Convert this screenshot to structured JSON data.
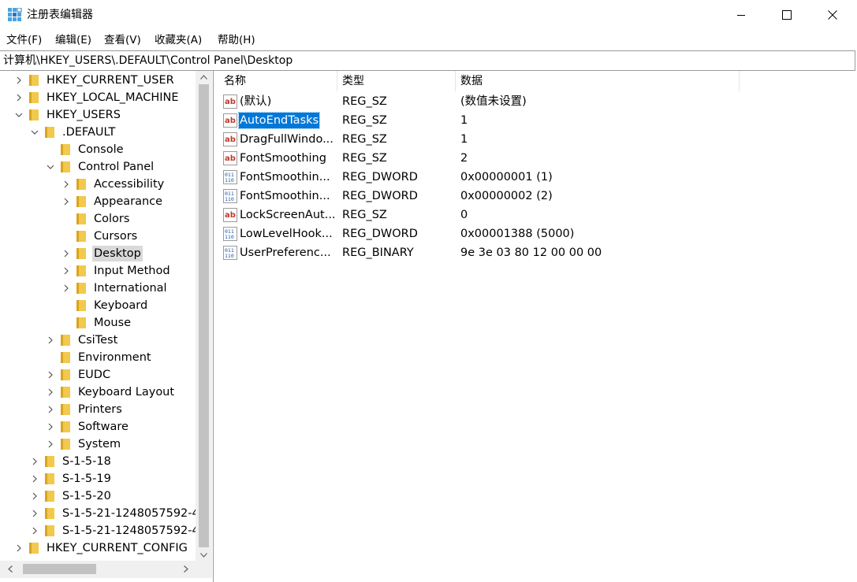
{
  "window": {
    "title": "注册表编辑器"
  },
  "menu": [
    {
      "label": "文件(F)"
    },
    {
      "label": "编辑(E)"
    },
    {
      "label": "查看(V)"
    },
    {
      "label": "收藏夹(A)"
    },
    {
      "label": "帮助(H)"
    }
  ],
  "address": "计算机\\HKEY_USERS\\.DEFAULT\\Control Panel\\Desktop",
  "tree": [
    {
      "label": "HKEY_CURRENT_USER",
      "level": 0,
      "exp": "collapsed"
    },
    {
      "label": "HKEY_LOCAL_MACHINE",
      "level": 0,
      "exp": "collapsed"
    },
    {
      "label": "HKEY_USERS",
      "level": 0,
      "exp": "expanded"
    },
    {
      "label": ".DEFAULT",
      "level": 1,
      "exp": "expanded"
    },
    {
      "label": "Console",
      "level": 2,
      "exp": "none"
    },
    {
      "label": "Control Panel",
      "level": 2,
      "exp": "expanded"
    },
    {
      "label": "Accessibility",
      "level": 3,
      "exp": "collapsed"
    },
    {
      "label": "Appearance",
      "level": 3,
      "exp": "collapsed"
    },
    {
      "label": "Colors",
      "level": 3,
      "exp": "none"
    },
    {
      "label": "Cursors",
      "level": 3,
      "exp": "none"
    },
    {
      "label": "Desktop",
      "level": 3,
      "exp": "collapsed",
      "selected": true
    },
    {
      "label": "Input Method",
      "level": 3,
      "exp": "collapsed"
    },
    {
      "label": "International",
      "level": 3,
      "exp": "collapsed"
    },
    {
      "label": "Keyboard",
      "level": 3,
      "exp": "none"
    },
    {
      "label": "Mouse",
      "level": 3,
      "exp": "none"
    },
    {
      "label": "CsiTest",
      "level": 2,
      "exp": "collapsed"
    },
    {
      "label": "Environment",
      "level": 2,
      "exp": "none"
    },
    {
      "label": "EUDC",
      "level": 2,
      "exp": "collapsed"
    },
    {
      "label": "Keyboard Layout",
      "level": 2,
      "exp": "collapsed"
    },
    {
      "label": "Printers",
      "level": 2,
      "exp": "collapsed"
    },
    {
      "label": "Software",
      "level": 2,
      "exp": "collapsed"
    },
    {
      "label": "System",
      "level": 2,
      "exp": "collapsed"
    },
    {
      "label": "S-1-5-18",
      "level": 1,
      "exp": "collapsed"
    },
    {
      "label": "S-1-5-19",
      "level": 1,
      "exp": "collapsed"
    },
    {
      "label": "S-1-5-20",
      "level": 1,
      "exp": "collapsed"
    },
    {
      "label": "S-1-5-21-1248057592-4",
      "level": 1,
      "exp": "collapsed"
    },
    {
      "label": "S-1-5-21-1248057592-4",
      "level": 1,
      "exp": "collapsed"
    },
    {
      "label": "HKEY_CURRENT_CONFIG",
      "level": 0,
      "exp": "collapsed"
    }
  ],
  "columns": {
    "name": "名称",
    "type": "类型",
    "data": "数据"
  },
  "values": [
    {
      "icon": "string-value-icon",
      "name": "(默认)",
      "type": "REG_SZ",
      "data": "(数值未设置)"
    },
    {
      "icon": "string-value-icon",
      "name": "AutoEndTasks",
      "type": "REG_SZ",
      "data": "1",
      "selected": true
    },
    {
      "icon": "string-value-icon",
      "name": "DragFullWindo...",
      "type": "REG_SZ",
      "data": "1"
    },
    {
      "icon": "string-value-icon",
      "name": "FontSmoothing",
      "type": "REG_SZ",
      "data": "2"
    },
    {
      "icon": "binary-value-icon",
      "name": "FontSmoothin...",
      "type": "REG_DWORD",
      "data": "0x00000001 (1)"
    },
    {
      "icon": "binary-value-icon",
      "name": "FontSmoothin...",
      "type": "REG_DWORD",
      "data": "0x00000002 (2)"
    },
    {
      "icon": "string-value-icon",
      "name": "LockScreenAut...",
      "type": "REG_SZ",
      "data": "0"
    },
    {
      "icon": "binary-value-icon",
      "name": "LowLevelHook...",
      "type": "REG_DWORD",
      "data": "0x00001388 (5000)"
    },
    {
      "icon": "binary-value-icon",
      "name": "UserPreferenc...",
      "type": "REG_BINARY",
      "data": "9e 3e 03 80 12 00 00 00"
    }
  ],
  "colors": {
    "selection": "#0078d7",
    "tree_selection": "#d9d9d9",
    "folder": "#f2c94c",
    "folder_dark": "#d9a520"
  }
}
